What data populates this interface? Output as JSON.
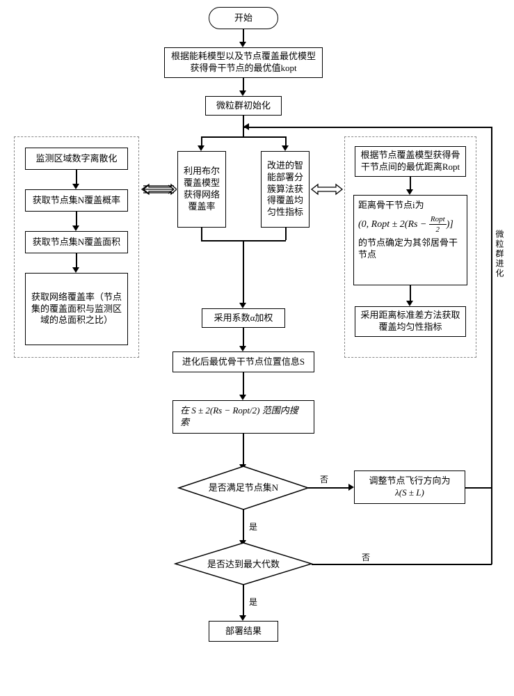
{
  "start": "开始",
  "step_kopt": "根据能耗模型以及节点覆盖最优模型获得骨干节点的最优值kopt",
  "step_init": "微粒群初始化",
  "step_boolean_cov": "利用布尔覆盖模型获得网络覆盖率",
  "step_improved_cluster": "改进的智能部署分簇算法获得覆盖均匀性指标",
  "step_alpha": "采用系数α加权",
  "step_evolved_s": "进化后最优骨干节点位置信息S",
  "step_search_range": "在 S ± 2(Rs − Ropt/2) 范围内搜索",
  "decision_n": "是否满足节点集N",
  "step_adjust_fly": "调整节点飞行方向为 λ(S ± L)",
  "decision_maxgen": "是否达到最大代数",
  "result": "部署结果",
  "left_group": {
    "a": "监测区域数字离散化",
    "b": "获取节点集N覆盖概率",
    "c": "获取节点集N覆盖面积",
    "d": "获取网络覆盖率（节点集的覆盖面积与监测区域的总面积之比）"
  },
  "right_group": {
    "a": "根据节点覆盖模型获得骨干节点间的最优距离Ropt",
    "b_prefix": "距离骨干节点i为",
    "b_formula_lead": "(0, Ropt ± 2(Rs − ",
    "b_formula_num": "Ropt",
    "b_formula_den": "2",
    "b_formula_tail": ")]",
    "b_suffix": "的节点确定为其邻居骨干节点",
    "c": "采用距离标准差方法获取覆盖均匀性指标"
  },
  "side_label": "微粒群进化",
  "yes": "是",
  "no": "否"
}
